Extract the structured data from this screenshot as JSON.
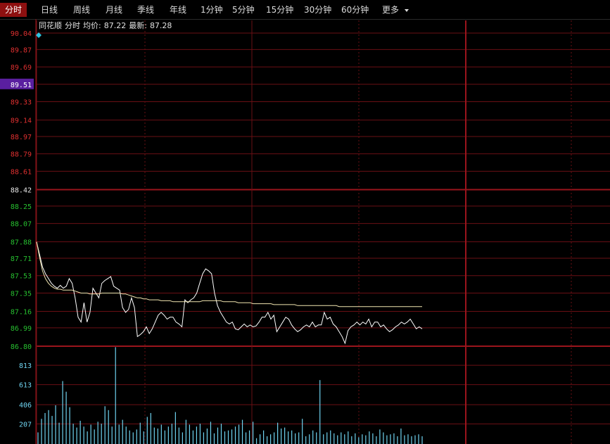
{
  "toolbar": {
    "tabs": [
      {
        "label": "分时",
        "active": true
      },
      {
        "label": "日线"
      },
      {
        "label": "周线"
      },
      {
        "label": "月线"
      },
      {
        "label": "季线"
      },
      {
        "label": "年线"
      },
      {
        "label": "1分钟"
      },
      {
        "label": "5分钟"
      },
      {
        "label": "15分钟"
      },
      {
        "label": "30分钟"
      },
      {
        "label": "60分钟"
      }
    ],
    "more_label": "更多",
    "more_icon": "caret-down-icon"
  },
  "info": {
    "brand": "同花顺",
    "mode": "分时",
    "avg_label": "均价:",
    "avg_value": "87.22",
    "last_label": "最新:",
    "last_value": "87.28"
  },
  "colors": {
    "up": "#e03030",
    "down": "#27c030",
    "neutral": "#e8e8e8",
    "grid": "#6a0f14",
    "grid_major": "#9a141c",
    "price_line": "#ffffff",
    "avg_line": "#f1e5b0",
    "volume": "#6fd3f0",
    "highlight_bg": "#5a1fa0"
  },
  "chart_data": [
    {
      "type": "line",
      "title": "",
      "ylim": [
        86.8,
        90.04
      ],
      "yticks": [
        "90.04",
        "89.87",
        "89.69",
        "89.51",
        "89.33",
        "89.14",
        "88.97",
        "88.79",
        "88.61",
        "88.42",
        "88.25",
        "88.07",
        "87.88",
        "87.71",
        "87.53",
        "87.35",
        "87.16",
        "86.99",
        "86.80"
      ],
      "reference_price": "88.42",
      "highlighted_tick": "89.51",
      "series": [
        {
          "role": "price",
          "values": [
            87.88,
            87.75,
            87.62,
            87.55,
            87.5,
            87.45,
            87.42,
            87.4,
            87.43,
            87.4,
            87.42,
            87.5,
            87.45,
            87.3,
            87.1,
            87.05,
            87.25,
            87.05,
            87.15,
            87.4,
            87.35,
            87.3,
            87.45,
            87.48,
            87.5,
            87.52,
            87.42,
            87.4,
            87.38,
            87.2,
            87.15,
            87.18,
            87.3,
            87.2,
            86.9,
            86.92,
            86.95,
            87.0,
            86.93,
            86.98,
            87.05,
            87.12,
            87.15,
            87.12,
            87.08,
            87.1,
            87.1,
            87.05,
            87.03,
            87.0,
            87.28,
            87.25,
            87.28,
            87.3,
            87.35,
            87.45,
            87.55,
            87.6,
            87.58,
            87.55,
            87.35,
            87.22,
            87.15,
            87.1,
            87.05,
            87.03,
            87.05,
            86.98,
            86.97,
            87.0,
            87.03,
            87.0,
            87.02,
            87.0,
            87.01,
            87.05,
            87.1,
            87.1,
            87.15,
            87.08,
            87.12,
            86.95,
            87.0,
            87.05,
            87.1,
            87.08,
            87.02,
            86.98,
            86.95,
            86.97,
            87.0,
            87.02,
            87.0,
            87.05,
            87.0,
            87.02,
            87.02,
            87.15,
            87.08,
            87.1,
            87.03,
            87.0,
            86.95,
            86.9,
            86.83,
            86.96,
            87.0,
            87.02,
            87.05,
            87.02,
            87.05,
            87.03,
            87.08,
            87.0,
            87.05,
            87.05,
            87.0,
            87.02,
            86.98,
            86.95,
            86.97,
            87.0,
            87.02,
            87.05,
            87.03,
            87.05,
            87.08,
            87.03,
            86.98,
            87.0,
            86.98
          ]
        },
        {
          "role": "average",
          "values": [
            87.88,
            87.72,
            87.58,
            87.5,
            87.45,
            87.42,
            87.4,
            87.39,
            87.39,
            87.38,
            87.38,
            87.38,
            87.38,
            87.37,
            87.36,
            87.35,
            87.35,
            87.35,
            87.34,
            87.34,
            87.34,
            87.34,
            87.35,
            87.35,
            87.35,
            87.35,
            87.35,
            87.35,
            87.35,
            87.34,
            87.34,
            87.33,
            87.32,
            87.31,
            87.3,
            87.3,
            87.29,
            87.29,
            87.28,
            87.28,
            87.28,
            87.28,
            87.27,
            87.27,
            87.27,
            87.27,
            87.26,
            87.26,
            87.26,
            87.26,
            87.26,
            87.26,
            87.26,
            87.26,
            87.26,
            87.26,
            87.27,
            87.27,
            87.27,
            87.27,
            87.27,
            87.27,
            87.27,
            87.26,
            87.26,
            87.26,
            87.26,
            87.26,
            87.25,
            87.25,
            87.25,
            87.25,
            87.25,
            87.24,
            87.24,
            87.24,
            87.24,
            87.24,
            87.24,
            87.24,
            87.23,
            87.23,
            87.23,
            87.23,
            87.23,
            87.23,
            87.23,
            87.23,
            87.22,
            87.22,
            87.22,
            87.22,
            87.22,
            87.22,
            87.22,
            87.22,
            87.22,
            87.22,
            87.22,
            87.22,
            87.22,
            87.22,
            87.21,
            87.21,
            87.21,
            87.21,
            87.21,
            87.21,
            87.21,
            87.21,
            87.21,
            87.21,
            87.21,
            87.21,
            87.21,
            87.21,
            87.21,
            87.21,
            87.21,
            87.21,
            87.21,
            87.21,
            87.21,
            87.21,
            87.21,
            87.21,
            87.21,
            87.21,
            87.21,
            87.21,
            87.21
          ]
        }
      ]
    },
    {
      "type": "bar",
      "ylim": [
        0,
        1010
      ],
      "yticks": [
        "813",
        "613",
        "406",
        "207"
      ],
      "values": [
        120,
        260,
        320,
        350,
        290,
        400,
        220,
        650,
        540,
        380,
        210,
        170,
        240,
        180,
        130,
        200,
        150,
        230,
        210,
        390,
        350,
        180,
        1000,
        200,
        250,
        180,
        140,
        120,
        150,
        220,
        130,
        280,
        320,
        170,
        160,
        200,
        140,
        180,
        210,
        330,
        170,
        120,
        250,
        200,
        140,
        180,
        210,
        120,
        160,
        230,
        110,
        170,
        210,
        130,
        140,
        150,
        180,
        200,
        250,
        120,
        140,
        230,
        60,
        100,
        140,
        80,
        100,
        120,
        220,
        160,
        170,
        130,
        140,
        110,
        120,
        260,
        80,
        100,
        140,
        120,
        660,
        100,
        120,
        140,
        110,
        90,
        120,
        100,
        130,
        80,
        110,
        70,
        100,
        90,
        130,
        110,
        80,
        150,
        120,
        90,
        100,
        110,
        80,
        160,
        90,
        100,
        80,
        90,
        100,
        80
      ]
    }
  ]
}
